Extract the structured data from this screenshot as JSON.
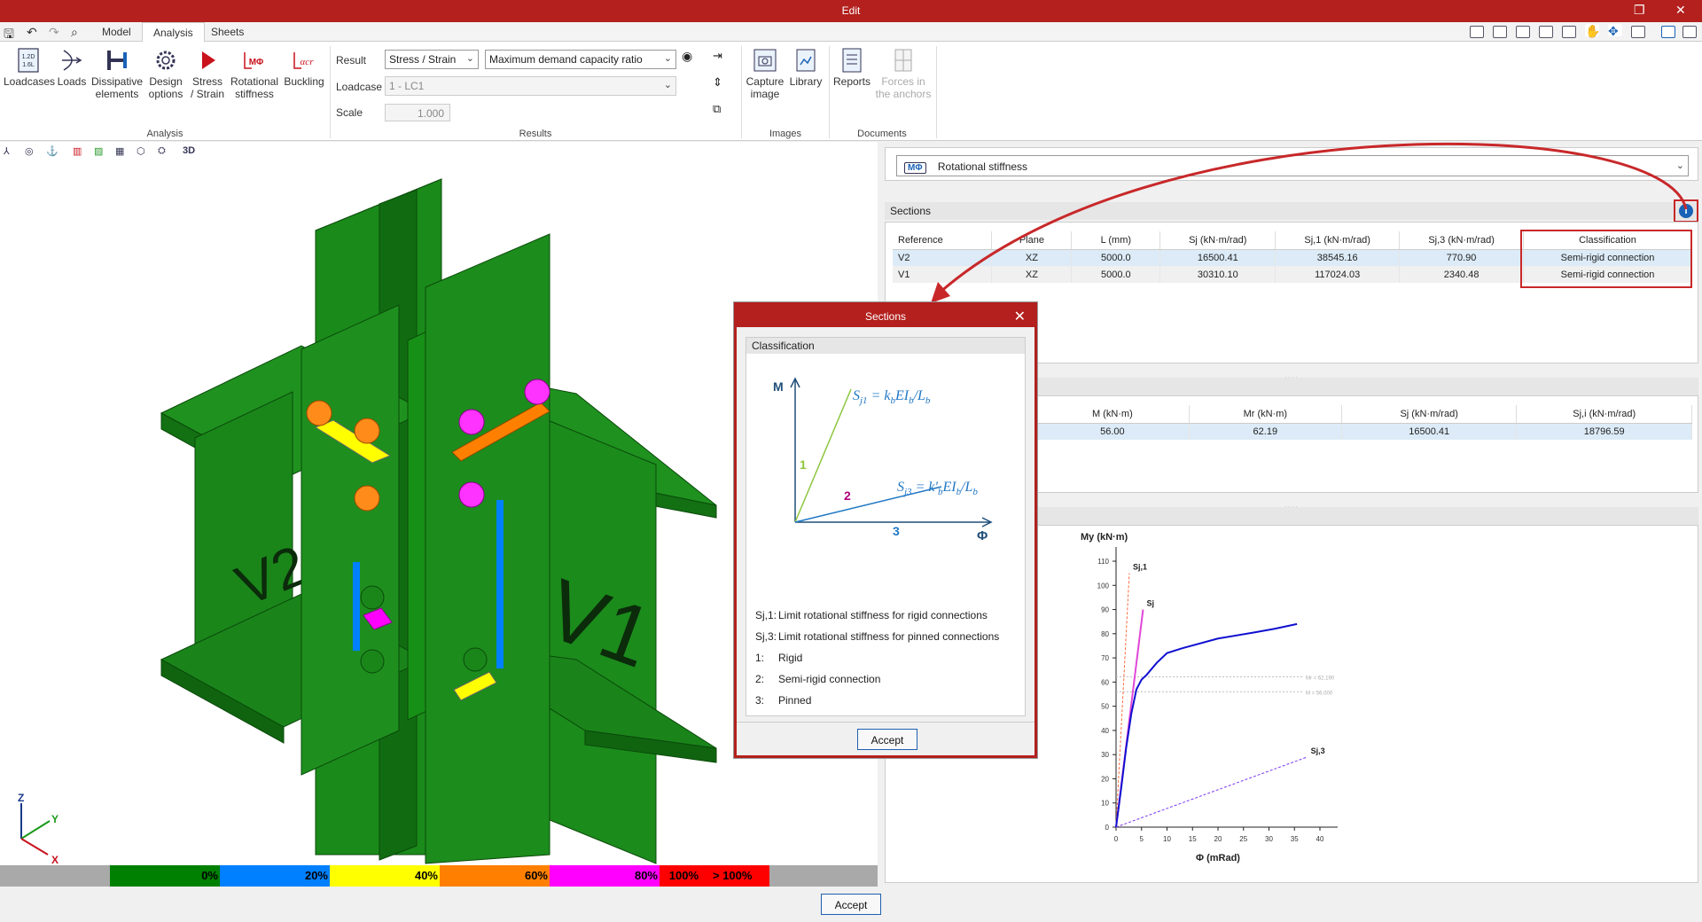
{
  "window": {
    "title": "Edit"
  },
  "tabs": [
    "Model",
    "Analysis",
    "Sheets"
  ],
  "ribbon": {
    "analysis_buttons": [
      {
        "l1": "Loadcases",
        "l2": ""
      },
      {
        "l1": "Loads",
        "l2": ""
      },
      {
        "l1": "Dissipative",
        "l2": "elements"
      },
      {
        "l1": "Design",
        "l2": "options"
      },
      {
        "l1": "Stress",
        "l2": "/ Strain"
      },
      {
        "l1": "Rotational",
        "l2": "stiffness"
      },
      {
        "l1": "Buckling",
        "l2": ""
      }
    ],
    "analysis_group": "Analysis",
    "result_label": "Result",
    "result_value": "Stress / Strain",
    "result_mode": "Maximum demand capacity ratio",
    "loadcase_label": "Loadcase",
    "loadcase_value": "1 - LC1",
    "scale_label": "Scale",
    "scale_value": "1.000",
    "results_group": "Results",
    "images_buttons": [
      {
        "l1": "Capture",
        "l2": "image"
      },
      {
        "l1": "Library",
        "l2": ""
      }
    ],
    "images_group": "Images",
    "documents_buttons": [
      {
        "l1": "Reports",
        "l2": ""
      },
      {
        "l1": "Forces in",
        "l2": "the anchors"
      }
    ],
    "documents_group": "Documents"
  },
  "viewport": {
    "labels": {
      "v1": "V1",
      "v2": "V2"
    },
    "axes": {
      "z": "Z",
      "y": "Y",
      "x": "X"
    },
    "view_mode": "3D"
  },
  "scale_legend": [
    {
      "label": "0%",
      "color": "#008000"
    },
    {
      "label": "20%",
      "color": "#0080ff"
    },
    {
      "label": "40%",
      "color": "#ffff00"
    },
    {
      "label": "60%",
      "color": "#ff8000"
    },
    {
      "label": "80%",
      "color": "#ff00ff"
    },
    {
      "label": "100%",
      "color": "#ff0000"
    },
    {
      "label": "> 100%",
      "color": "#ff0000"
    }
  ],
  "bottom": {
    "accept_label": "Accept"
  },
  "right_panel": {
    "dropdown_value": "Rotational stiffness",
    "dropdown_icon_text": "MΦ",
    "sections_title": "Sections",
    "sections_table": {
      "headers": [
        "Reference",
        "Plane",
        "L (mm)",
        "Sj (kN·m/rad)",
        "Sj,1 (kN·m/rad)",
        "Sj,3 (kN·m/rad)",
        "Classification"
      ],
      "rows": [
        [
          "V2",
          "XZ",
          "5000.0",
          "16500.41",
          "38545.16",
          "770.90",
          "Semi-rigid connection"
        ],
        [
          "V1",
          "XZ",
          "5000.0",
          "30310.10",
          "117024.03",
          "2340.48",
          "Semi-rigid connection"
        ]
      ]
    },
    "second_table": {
      "headers": [
        "M (kN·m)",
        "Mr (kN·m)",
        "Sj (kN·m/rad)",
        "Sj,i (kN·m/rad)"
      ],
      "rows": [
        [
          "56.00",
          "62.19",
          "16500.41",
          "18796.59"
        ]
      ]
    },
    "splitter_dots": "...."
  },
  "chart_data": {
    "type": "line",
    "title": "",
    "ylabel": "My (kN·m)",
    "xlabel": "Φ (mRad)",
    "xlim": [
      0,
      40
    ],
    "ylim": [
      0,
      110
    ],
    "x_ticks": [
      0,
      5,
      10,
      15,
      20,
      25,
      30,
      35,
      40
    ],
    "y_ticks": [
      0,
      10,
      20,
      30,
      40,
      50,
      60,
      70,
      80,
      90,
      100,
      110
    ],
    "series": [
      {
        "name": "Sj,1",
        "style": "dashed",
        "color": "#ff6a3d",
        "x": [
          0,
          2.6
        ],
        "y": [
          0,
          105
        ]
      },
      {
        "name": "Sj",
        "style": "solid",
        "color": "#e048d8",
        "x": [
          0,
          5.3
        ],
        "y": [
          0,
          90
        ]
      },
      {
        "name": "",
        "style": "solid",
        "color": "#1010d0",
        "x": [
          0,
          1,
          2,
          3,
          4,
          5,
          6,
          8,
          10,
          13,
          20,
          27,
          31,
          35.5
        ],
        "y": [
          0,
          16,
          33,
          47,
          57,
          61,
          63,
          68,
          72,
          74,
          78,
          80.5,
          82,
          84
        ]
      },
      {
        "name": "Sj,3",
        "style": "dashed",
        "color": "#7a3af0",
        "x": [
          0,
          37.5
        ],
        "y": [
          0,
          29
        ]
      }
    ],
    "ref_lines": [
      {
        "label": "Mr = 62.190",
        "y": 62.19
      },
      {
        "label": "M = 56.000",
        "y": 56.0
      }
    ],
    "grid": false
  },
  "dialog": {
    "title": "Sections",
    "section_label": "Classification",
    "diagram": {
      "m_axis": "M",
      "phi_axis": "Φ",
      "zone1": "1",
      "zone2": "2",
      "zone3": "3"
    },
    "legend": [
      {
        "key": "Sj,1:",
        "text": "Limit rotational stiffness for rigid connections"
      },
      {
        "key": "Sj,3:",
        "text": "Limit rotational stiffness for pinned connections"
      },
      {
        "key": "1:",
        "text": "Rigid"
      },
      {
        "key": "2:",
        "text": "Semi-rigid connection"
      },
      {
        "key": "3:",
        "text": "Pinned"
      }
    ],
    "accept_label": "Accept",
    "colors": {
      "frame": "#b3201d",
      "line1": "#8dc63f",
      "line3": "#1f77c4",
      "zone2": "#b0007f"
    }
  }
}
